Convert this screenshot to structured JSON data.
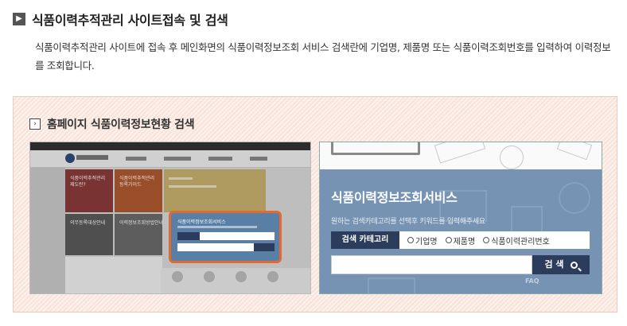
{
  "section": {
    "icon": "chevron-right-icon",
    "title": "식품이력추적관리 사이트접속 및 검색",
    "description": "식품이력추적관리 사이트에 접속 후 메인화면의 식품이력정보조회 서비스 검색란에 기업명, 제품명 또는 식품이력조회번호를 입력하여 이력정보를 조회합니다."
  },
  "box": {
    "icon": "chevron-right-icon",
    "title": "홈페이지 식품이력정보현황 검색",
    "highlight_color": "#e06a2f",
    "screenshot_left": {
      "tiles": [
        "식품이력추적관리 제도란?",
        "식품이력추적관리 등록가이드",
        "의무등록대상안내",
        "이력정보조회방법안내",
        "식품이력정보조회서비스"
      ]
    },
    "screenshot_right": {
      "service_title": "식품이력정보조회서비스",
      "hint": "원하는 검색카테고리를 선택후 키워드를 입력해주세요",
      "category_label": "검색 카테고리",
      "options": [
        "기업명",
        "제품명",
        "식품이력관리번호"
      ],
      "search_button": "검 색",
      "faq": "FAQ"
    }
  }
}
